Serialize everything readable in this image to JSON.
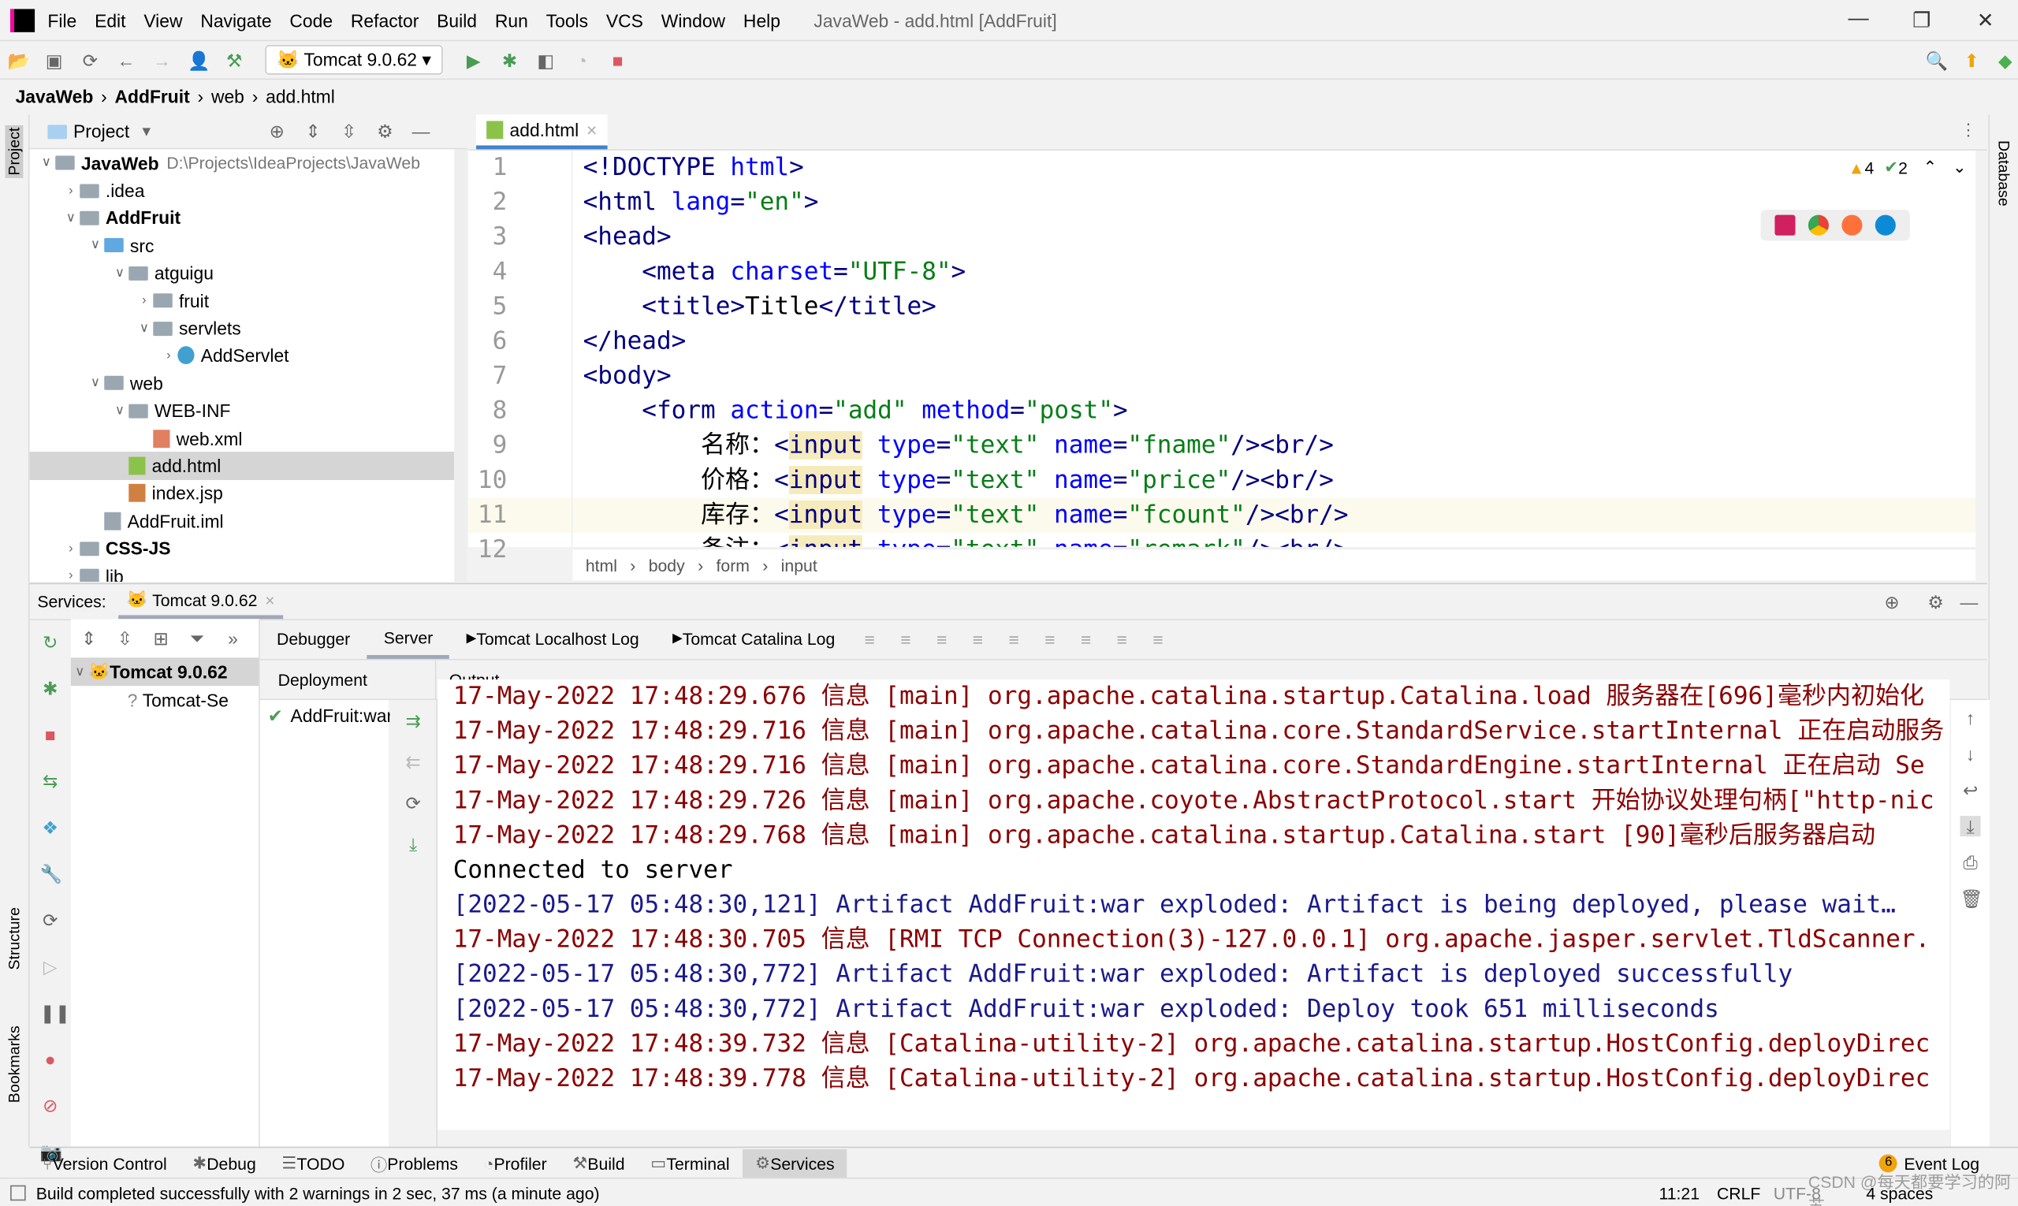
{
  "window": {
    "title": "JavaWeb - add.html [AddFruit]"
  },
  "menu": [
    "File",
    "Edit",
    "View",
    "Navigate",
    "Code",
    "Refactor",
    "Build",
    "Run",
    "Tools",
    "VCS",
    "Window",
    "Help"
  ],
  "toolbar": {
    "run_config": "Tomcat 9.0.62"
  },
  "breadcrumb": [
    "JavaWeb",
    "AddFruit",
    "web",
    "add.html"
  ],
  "project": {
    "title": "Project",
    "tree": [
      {
        "label": "JavaWeb",
        "path": "D:\\Projects\\IdeaProjects\\JavaWeb",
        "level": 0,
        "open": true,
        "type": "module",
        "bold": true
      },
      {
        "label": ".idea",
        "level": 1,
        "open": false,
        "type": "folder"
      },
      {
        "label": "AddFruit",
        "level": 1,
        "open": true,
        "type": "module",
        "bold": true
      },
      {
        "label": "src",
        "level": 2,
        "open": true,
        "type": "src"
      },
      {
        "label": "atguigu",
        "level": 3,
        "open": true,
        "type": "folder"
      },
      {
        "label": "fruit",
        "level": 4,
        "open": false,
        "type": "folder"
      },
      {
        "label": "servlets",
        "level": 4,
        "open": true,
        "type": "folder"
      },
      {
        "label": "AddServlet",
        "level": 5,
        "open": false,
        "type": "class"
      },
      {
        "label": "web",
        "level": 2,
        "open": true,
        "type": "web"
      },
      {
        "label": "WEB-INF",
        "level": 3,
        "open": true,
        "type": "folder"
      },
      {
        "label": "web.xml",
        "level": 4,
        "type": "xml"
      },
      {
        "label": "add.html",
        "level": 3,
        "type": "html",
        "selected": true
      },
      {
        "label": "index.jsp",
        "level": 3,
        "type": "jsp"
      },
      {
        "label": "AddFruit.iml",
        "level": 2,
        "type": "iml"
      },
      {
        "label": "CSS-JS",
        "level": 1,
        "open": false,
        "type": "module",
        "bold": true
      },
      {
        "label": "lib",
        "level": 1,
        "open": false,
        "type": "folder"
      }
    ]
  },
  "editor": {
    "tab": "add.html",
    "warnings": "4",
    "checks": "2",
    "current_line": 11,
    "lines": [
      [
        [
          "tag",
          "<!DOCTYPE "
        ],
        [
          "attr",
          "html"
        ],
        [
          "tag",
          ">"
        ]
      ],
      [
        [
          "tag",
          "<html "
        ],
        [
          "attr",
          "lang"
        ],
        [
          "tag",
          "="
        ],
        [
          "val",
          "\"en\""
        ],
        [
          "tag",
          ">"
        ]
      ],
      [
        [
          "tag",
          "<head>"
        ]
      ],
      [
        [
          "txt",
          "    "
        ],
        [
          "tag",
          "<meta "
        ],
        [
          "attr",
          "charset"
        ],
        [
          "tag",
          "="
        ],
        [
          "val",
          "\"UTF-8\""
        ],
        [
          "tag",
          ">"
        ]
      ],
      [
        [
          "txt",
          "    "
        ],
        [
          "tag",
          "<title>"
        ],
        [
          "txt",
          "Title"
        ],
        [
          "tag",
          "</title>"
        ]
      ],
      [
        [
          "tag",
          "</head>"
        ]
      ],
      [
        [
          "tag",
          "<body>"
        ]
      ],
      [
        [
          "txt",
          "    "
        ],
        [
          "tag",
          "<form "
        ],
        [
          "attr",
          "action"
        ],
        [
          "tag",
          "="
        ],
        [
          "val",
          "\"add\" "
        ],
        [
          "attr",
          "method"
        ],
        [
          "tag",
          "="
        ],
        [
          "val",
          "\"post\""
        ],
        [
          "tag",
          ">"
        ]
      ],
      [
        [
          "txt",
          "        名称："
        ],
        [
          "tag",
          "<"
        ],
        [
          "hl",
          "input"
        ],
        [
          "txt",
          " "
        ],
        [
          "attr",
          "type"
        ],
        [
          "tag",
          "="
        ],
        [
          "val",
          "\"text\" "
        ],
        [
          "attr",
          "name"
        ],
        [
          "tag",
          "="
        ],
        [
          "val",
          "\"fname\""
        ],
        [
          "tag",
          "/><br/>"
        ]
      ],
      [
        [
          "txt",
          "        价格："
        ],
        [
          "tag",
          "<"
        ],
        [
          "hl",
          "input"
        ],
        [
          "txt",
          " "
        ],
        [
          "attr",
          "type"
        ],
        [
          "tag",
          "="
        ],
        [
          "val",
          "\"text\" "
        ],
        [
          "attr",
          "name"
        ],
        [
          "tag",
          "="
        ],
        [
          "val",
          "\"price\""
        ],
        [
          "tag",
          "/><br/>"
        ]
      ],
      [
        [
          "txt",
          "        库存："
        ],
        [
          "tag",
          "<"
        ],
        [
          "hl",
          "input"
        ],
        [
          "txt",
          " "
        ],
        [
          "attr",
          "type"
        ],
        [
          "tag",
          "="
        ],
        [
          "val",
          "\"text\" "
        ],
        [
          "attr",
          "name"
        ],
        [
          "tag",
          "="
        ],
        [
          "val",
          "\"fcount\""
        ],
        [
          "tag",
          "/><br/>"
        ]
      ],
      [
        [
          "txt",
          "        备注："
        ],
        [
          "tag",
          "<"
        ],
        [
          "hl",
          "input"
        ],
        [
          "txt",
          " "
        ],
        [
          "attr",
          "type"
        ],
        [
          "tag",
          "="
        ],
        [
          "val",
          "\"text\" "
        ],
        [
          "attr",
          "name"
        ],
        [
          "tag",
          "="
        ],
        [
          "val",
          "\"remark\""
        ],
        [
          "tag",
          "/><br/>"
        ]
      ]
    ],
    "crumbs": [
      "html",
      "body",
      "form",
      "input"
    ]
  },
  "services": {
    "label": "Services:",
    "tab": "Tomcat 9.0.62",
    "tree": [
      {
        "label": "Tomcat 9.0.62",
        "bold": true
      },
      {
        "label": "Tomcat-Se"
      }
    ],
    "subtabs": [
      "Debugger",
      "Server",
      "Tomcat Localhost Log",
      "Tomcat Catalina Log"
    ],
    "deployment_header": "Deployment",
    "output_header": "Output",
    "deployment_item": "AddFruit:war",
    "log": [
      {
        "c": "#8b0000",
        "t": "17-May-2022 17:48:29.676 信息 [main] org.apache.catalina.startup.Catalina.load 服务器在[696]毫秒内初始化"
      },
      {
        "c": "#8b0000",
        "t": "17-May-2022 17:48:29.716 信息 [main] org.apache.catalina.core.StandardService.startInternal 正在启动服务"
      },
      {
        "c": "#8b0000",
        "t": "17-May-2022 17:48:29.716 信息 [main] org.apache.catalina.core.StandardEngine.startInternal 正在启动 Se"
      },
      {
        "c": "#8b0000",
        "t": "17-May-2022 17:48:29.726 信息 [main] org.apache.coyote.AbstractProtocol.start 开始协议处理句柄[\"http-nic"
      },
      {
        "c": "#8b0000",
        "t": "17-May-2022 17:48:29.768 信息 [main] org.apache.catalina.startup.Catalina.start [90]毫秒后服务器启动"
      },
      {
        "c": "#000000",
        "t": "Connected to server"
      },
      {
        "c": "#1a1a8c",
        "t": "[2022-05-17 05:48:30,121] Artifact AddFruit:war exploded: Artifact is being deployed, please wait…"
      },
      {
        "c": "#8b0000",
        "t": "17-May-2022 17:48:30.705 信息 [RMI TCP Connection(3)-127.0.0.1] org.apache.jasper.servlet.TldScanner."
      },
      {
        "c": "#1a1a8c",
        "t": "[2022-05-17 05:48:30,772] Artifact AddFruit:war exploded: Artifact is deployed successfully"
      },
      {
        "c": "#1a1a8c",
        "t": "[2022-05-17 05:48:30,772] Artifact AddFruit:war exploded: Deploy took 651 milliseconds"
      },
      {
        "c": "#8b0000",
        "t": "17-May-2022 17:48:39.732 信息 [Catalina-utility-2] org.apache.catalina.startup.HostConfig.deployDirec"
      },
      {
        "c": "#8b0000",
        "t": "17-May-2022 17:48:39.778 信息 [Catalina-utility-2] org.apache.catalina.startup.HostConfig.deployDirec"
      }
    ]
  },
  "bottom_tabs": [
    "Version Control",
    "Debug",
    "TODO",
    "Problems",
    "Profiler",
    "Build",
    "Terminal",
    "Services"
  ],
  "event_log": {
    "count": "6",
    "label": "Event Log"
  },
  "side": {
    "project": "Project",
    "structure": "Structure",
    "bookmarks": "Bookmarks",
    "database": "Database"
  },
  "status": {
    "message": "Build completed successfully with 2 warnings in 2 sec, 37 ms (a minute ago)",
    "position": "11:21",
    "line_sep": "CRLF",
    "encoding": "UTF-8",
    "indent": "4 spaces",
    "watermark": "CSDN @每天都要学习的阿苏"
  },
  "colors": {
    "accent": "#4083c9",
    "run": "#499c54",
    "stop": "#db5860",
    "warning": "#f0a30a"
  }
}
